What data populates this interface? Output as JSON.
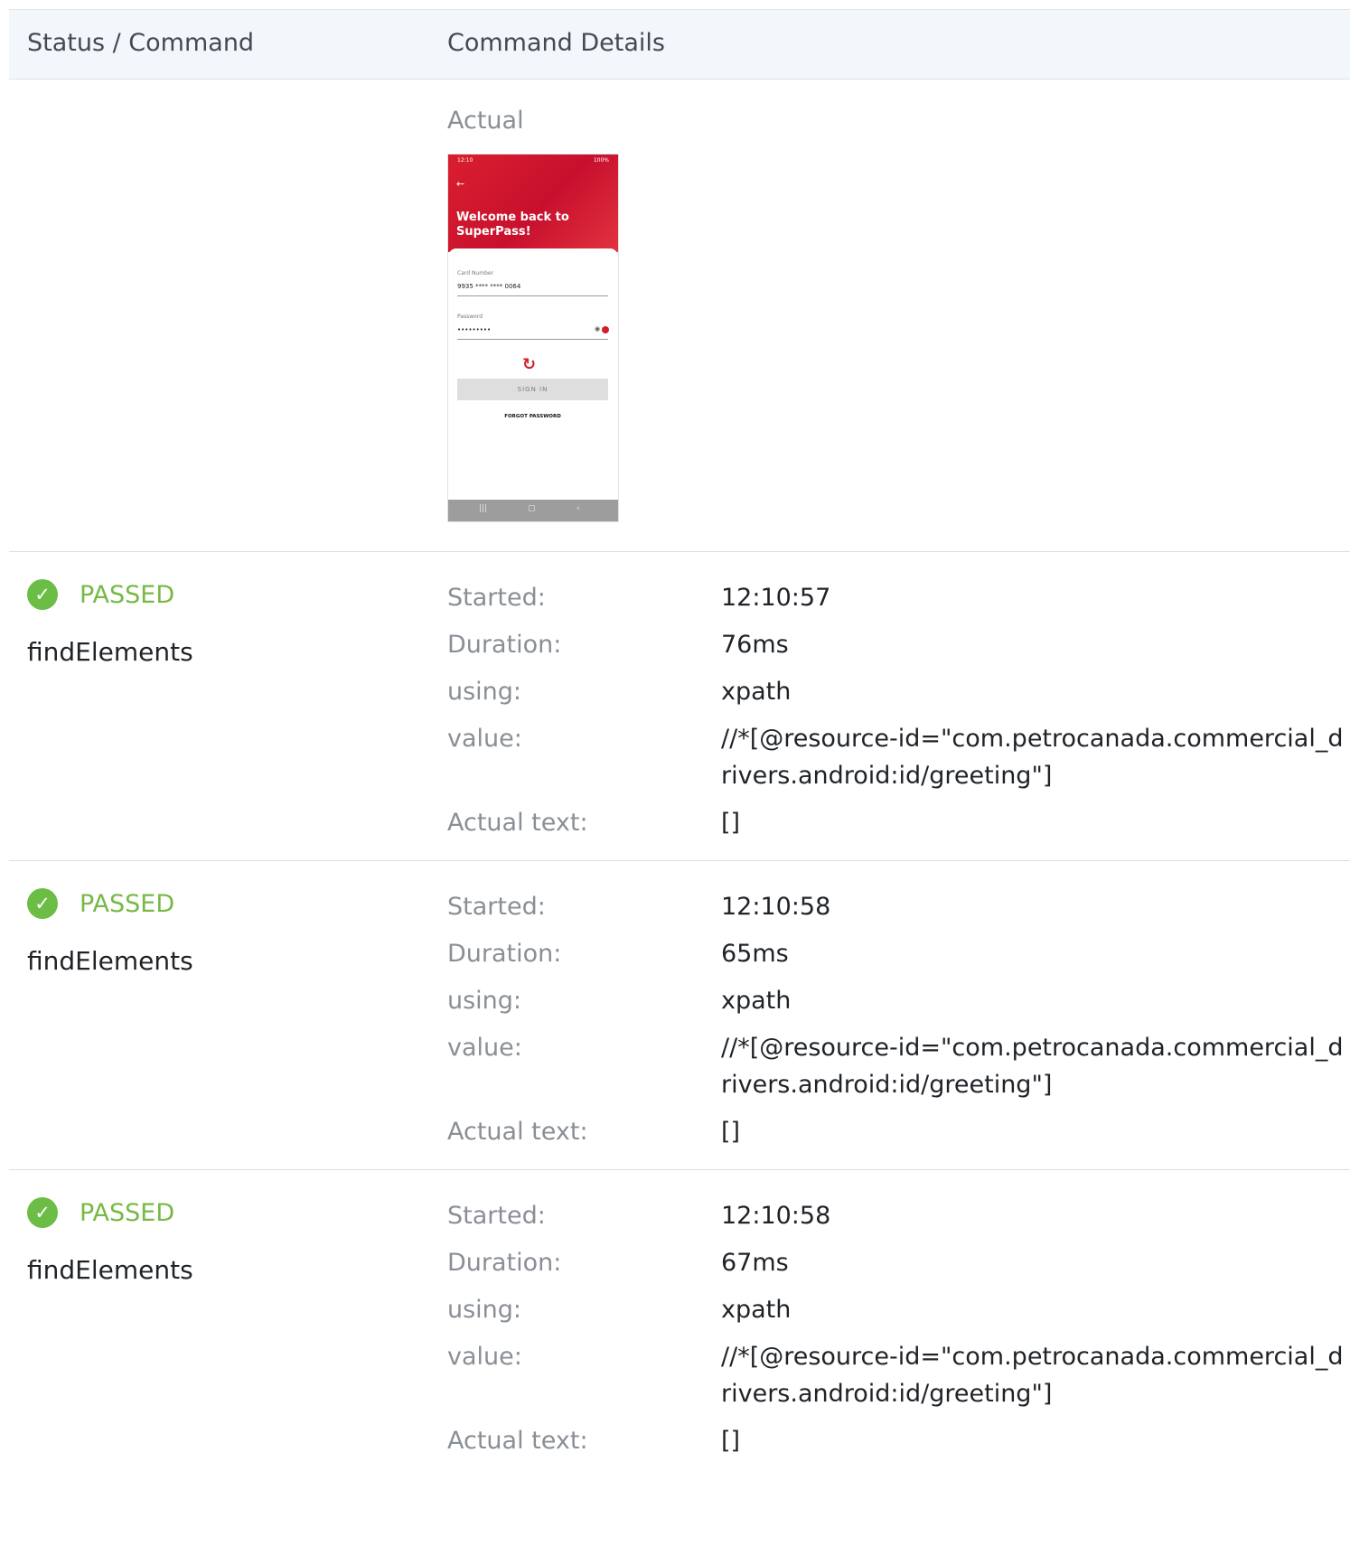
{
  "header": {
    "col_status": "Status / Command",
    "col_details": "Command Details"
  },
  "screenshot": {
    "label": "Actual",
    "phone": {
      "status_time": "12:10",
      "status_right": "100%",
      "welcome": "Welcome back to SuperPass!",
      "card_label": "Card Number",
      "card_value": "9935 **** **** 0064",
      "password_label": "Password",
      "password_value": "•••••••••",
      "signin": "SIGN IN",
      "forgot": "FORGOT PASSWORD",
      "brand_color": "#c8102e"
    }
  },
  "labels": {
    "started": "Started:",
    "duration": "Duration:",
    "using": "using:",
    "value": "value:",
    "actual_text": "Actual text:"
  },
  "commands": [
    {
      "status": "PASSED",
      "name": "findElements",
      "started": "12:10:57",
      "duration": "76ms",
      "using": "xpath",
      "value": "//*[@resource-id=\"com.petrocanada.commercial_drivers.android:id/greeting\"]",
      "actual_text": "[]"
    },
    {
      "status": "PASSED",
      "name": "findElements",
      "started": "12:10:58",
      "duration": "65ms",
      "using": "xpath",
      "value": "//*[@resource-id=\"com.petrocanada.commercial_drivers.android:id/greeting\"]",
      "actual_text": "[]"
    },
    {
      "status": "PASSED",
      "name": "findElements",
      "started": "12:10:58",
      "duration": "67ms",
      "using": "xpath",
      "value": "//*[@resource-id=\"com.petrocanada.commercial_drivers.android:id/greeting\"]",
      "actual_text": "[]"
    }
  ],
  "colors": {
    "passed": "#76b944",
    "header_bg": "#f3f6fa",
    "label": "#8a8f96"
  }
}
